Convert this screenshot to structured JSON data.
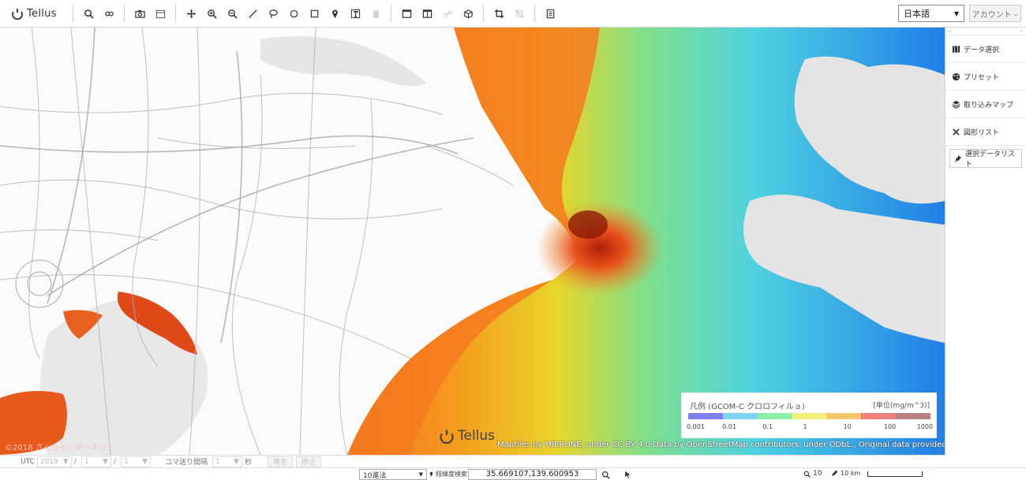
{
  "toolbar": {
    "logo_text": "Tellus",
    "language": "日本語",
    "account_label": "アカウント"
  },
  "map": {
    "logo_text": "Tellus",
    "attribution": "Maptiles by MIERUNE, under CC BY 4.0 Data by OpenStreetMap contributors, under ODbL., Original data provided by JAXA",
    "copyright": "©2018 さくらインターネット"
  },
  "legend": {
    "title": "凡例 (GCOM-C クロロフィルａ)",
    "unit": "[単位(mg/m^3)]",
    "colors": [
      "#7f7ff0",
      "#7fd6f5",
      "#8ff0a8",
      "#eef07a",
      "#f5c86e",
      "#f07f7f",
      "#b88080"
    ],
    "ticks": [
      "0.001",
      "0.01",
      "0.1",
      "1",
      "10",
      "100",
      "1000"
    ]
  },
  "panel": {
    "items": [
      {
        "label": "データ選択"
      },
      {
        "label": "プリセット"
      },
      {
        "label": "取り込みマップ"
      },
      {
        "label": "図形リスト"
      },
      {
        "label": "選択データリスト"
      }
    ]
  },
  "timebar": {
    "utc_label": "UTC",
    "year": "2019",
    "month": "1",
    "day": "1",
    "interval_label": "コマ送り間隔",
    "interval_value": "1",
    "interval_unit": "秒",
    "play_label": "再生",
    "stop_label": "停止"
  },
  "statusbar": {
    "notation": "10進法",
    "coord_label": "経緯度検索",
    "coordinates": "35.669107,139.600953",
    "zoom": "10",
    "scale": "10 km"
  }
}
